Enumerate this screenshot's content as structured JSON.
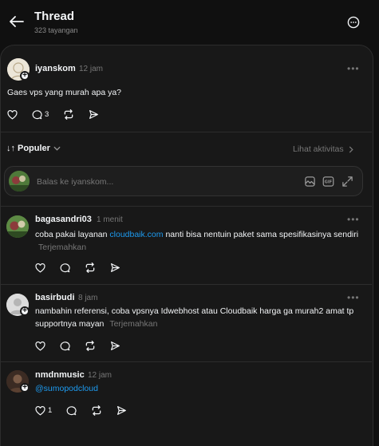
{
  "header": {
    "title": "Thread",
    "views": "323 tayangan"
  },
  "root_post": {
    "username": "iyanskom",
    "time": "12 jam",
    "text": "Gaes vps yang murah apa ya?",
    "reply_count": "3",
    "avatar_icon": "avatar-placeholder-icon"
  },
  "sort": {
    "label": "Populer",
    "activity_link": "Lihat aktivitas"
  },
  "reply_box": {
    "placeholder": "Balas ke iyanskom..."
  },
  "replies": [
    {
      "username": "bagasandri03",
      "time": "1 menit",
      "text_before": "coba pakai layanan ",
      "link": "cloudbaik.com",
      "text_after": " nanti bisa nentuin paket sama spesifikasinya sendiri",
      "translate": "Terjemahkan"
    },
    {
      "username": "basirbudi",
      "time": "8 jam",
      "text": "nambahin referensi, coba vpsnya Idwebhost atau Cloudbaik harga ga murah2 amat tp supportnya mayan",
      "translate": "Terjemahkan"
    },
    {
      "username": "nmdnmusic",
      "time": "12 jam",
      "mention": "@sumopodcloud",
      "like_count": "1"
    }
  ],
  "colors": {
    "background": "#101010",
    "panel": "#181818",
    "link": "#1d9bf0",
    "muted": "#777777"
  }
}
